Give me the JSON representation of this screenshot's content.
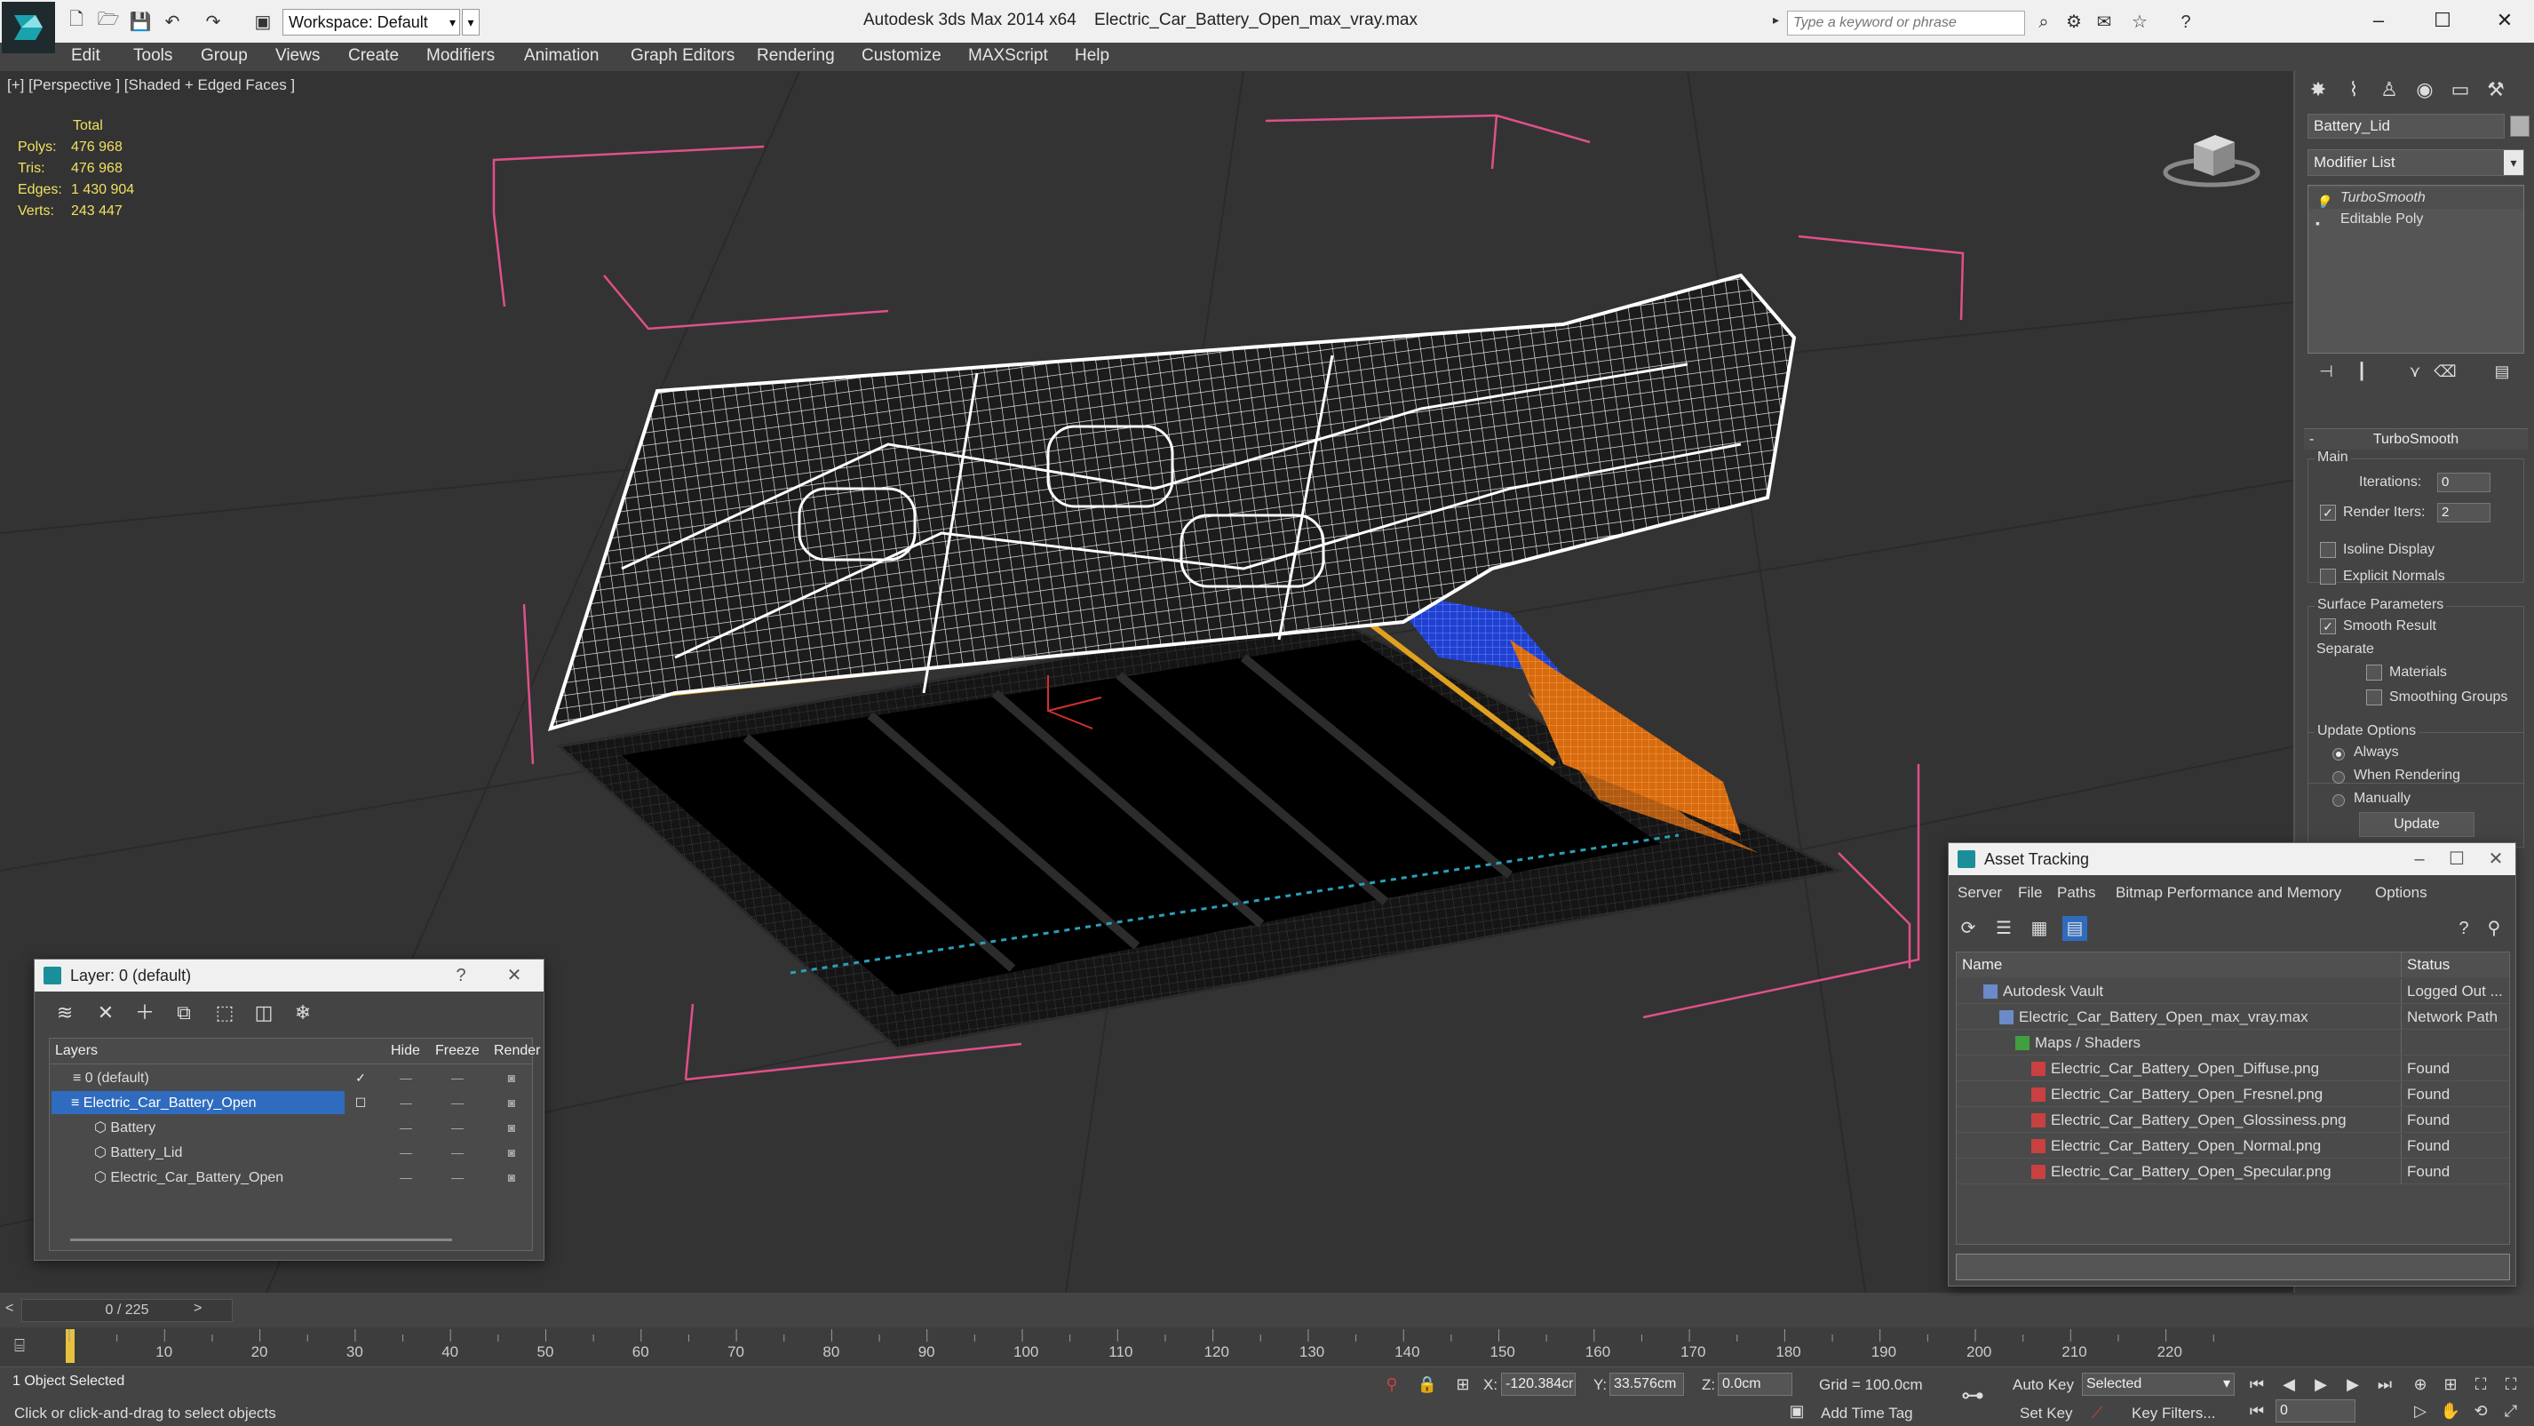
{
  "titlebar": {
    "workspace": "Workspace: Default",
    "app_title": "Autodesk 3ds Max  2014 x64",
    "file_title": "Electric_Car_Battery_Open_max_vray.max",
    "search_placeholder": "Type a keyword or phrase"
  },
  "menu": [
    "Edit",
    "Tools",
    "Group",
    "Views",
    "Create",
    "Modifiers",
    "Animation",
    "Graph Editors",
    "Rendering",
    "Customize",
    "MAXScript",
    "Help"
  ],
  "viewport": {
    "label": "[+] [Perspective ] [Shaded + Edged Faces ]",
    "stats_header": "Total",
    "stats": [
      {
        "label": "Polys:",
        "value": "476 968"
      },
      {
        "label": "Tris:",
        "value": "476 968"
      },
      {
        "label": "Edges:",
        "value": "1 430 904"
      },
      {
        "label": "Verts:",
        "value": "243 447"
      }
    ]
  },
  "command_panel": {
    "object_name": "Battery_Lid",
    "modifier_list": "Modifier List",
    "stack": [
      "TurboSmooth",
      "Editable Poly"
    ],
    "rollout": "TurboSmooth",
    "main_label": "Main",
    "iterations_label": "Iterations:",
    "iterations_value": "0",
    "render_iters_label": "Render Iters:",
    "render_iters_value": "2",
    "isoline": "Isoline Display",
    "explicit_normals": "Explicit Normals",
    "surface_params": "Surface Parameters",
    "smooth_result": "Smooth Result",
    "separate": "Separate",
    "materials": "Materials",
    "smoothing_groups": "Smoothing Groups",
    "update_options": "Update Options",
    "always": "Always",
    "when_rendering": "When Rendering",
    "manually": "Manually",
    "update_button": "Update"
  },
  "layer_dialog": {
    "title": "Layer: 0 (default)",
    "help": "?",
    "columns": [
      "Layers",
      "Hide",
      "Freeze",
      "Render"
    ],
    "rows": [
      {
        "name": "0 (default)",
        "indent": 0
      },
      {
        "name": "Electric_Car_Battery_Open",
        "indent": 0
      },
      {
        "name": "Battery",
        "indent": 1
      },
      {
        "name": "Battery_Lid",
        "indent": 1
      },
      {
        "name": "Electric_Car_Battery_Open",
        "indent": 1
      }
    ]
  },
  "asset_dialog": {
    "title": "Asset Tracking",
    "menu": [
      "Server",
      "File",
      "Paths",
      "Bitmap Performance and Memory",
      "Options"
    ],
    "columns": [
      "Name",
      "Status"
    ],
    "rows": [
      {
        "name": "Autodesk Vault",
        "status": "Logged Out ...",
        "indent": 1,
        "icon": "vault-icon"
      },
      {
        "name": "Electric_Car_Battery_Open_max_vray.max",
        "status": "Network Path",
        "indent": 2,
        "icon": "max-file-icon"
      },
      {
        "name": "Maps / Shaders",
        "status": "",
        "indent": 3,
        "icon": "maps-icon"
      },
      {
        "name": "Electric_Car_Battery_Open_Diffuse.png",
        "status": "Found",
        "indent": 4,
        "icon": "png-icon"
      },
      {
        "name": "Electric_Car_Battery_Open_Fresnel.png",
        "status": "Found",
        "indent": 4,
        "icon": "png-icon"
      },
      {
        "name": "Electric_Car_Battery_Open_Glossiness.png",
        "status": "Found",
        "indent": 4,
        "icon": "png-icon"
      },
      {
        "name": "Electric_Car_Battery_Open_Normal.png",
        "status": "Found",
        "indent": 4,
        "icon": "png-icon"
      },
      {
        "name": "Electric_Car_Battery_Open_Specular.png",
        "status": "Found",
        "indent": 4,
        "icon": "png-icon"
      }
    ]
  },
  "timeline": {
    "frame_display": "0 / 225",
    "ticks": [
      "10",
      "20",
      "30",
      "40",
      "50",
      "60",
      "70",
      "80",
      "90",
      "100",
      "110",
      "120",
      "130",
      "140",
      "150",
      "160",
      "170",
      "180",
      "190",
      "200",
      "210",
      "220"
    ]
  },
  "statusbar": {
    "selection": "1 Object Selected",
    "prompt": "Click or click-and-drag to select objects",
    "x_label": "X:",
    "x_value": "-120.384cr",
    "y_label": "Y:",
    "y_value": "33.576cm",
    "z_label": "Z:",
    "z_value": "0.0cm",
    "grid": "Grid = 100.0cm",
    "auto_key": "Auto Key",
    "selected_dd": "Selected",
    "set_key": "Set Key",
    "key_filters": "Key Filters...",
    "add_time_tag": "Add Time Tag",
    "frame_value": "0"
  },
  "colors": {
    "selection_blue": "#2f6cbf",
    "stats_yellow": "#f0e060",
    "bbox_pink": "#e0508a",
    "wire_white": "#ffffff",
    "battery_orange": "#e07818",
    "battery_blue": "#2848d8"
  }
}
